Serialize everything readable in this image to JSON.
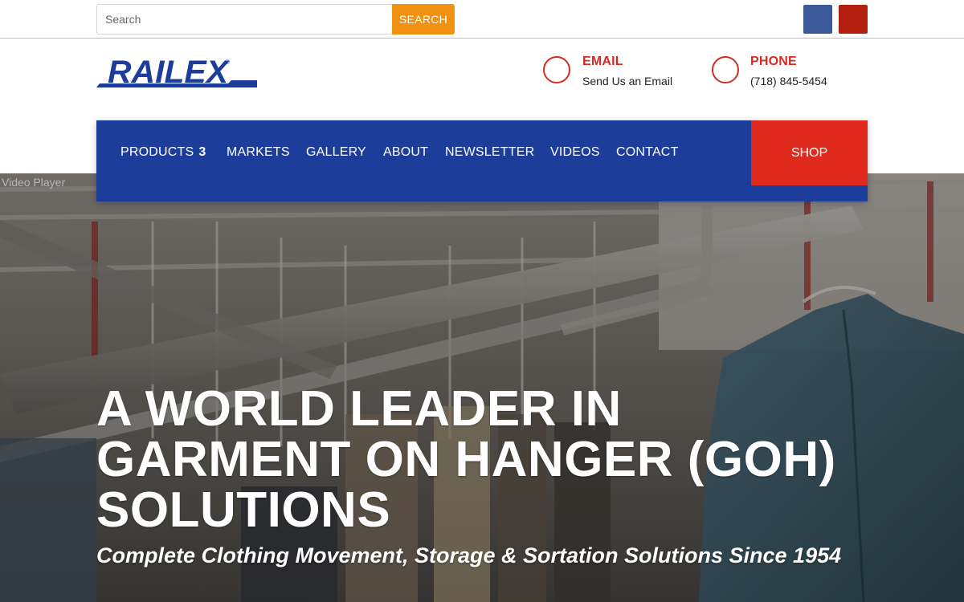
{
  "search": {
    "placeholder": "Search",
    "button_label": "SEARCH"
  },
  "social": [
    {
      "icon": "facebook-icon",
      "color": "#3b5998"
    },
    {
      "icon": "youtube-icon",
      "color": "#b3200f"
    }
  ],
  "brand": {
    "logo_text": "RAILEX",
    "color": "#1d3d9a"
  },
  "contact": {
    "email": {
      "title": "EMAIL",
      "subtitle": "Send Us an Email",
      "icon": "email-icon"
    },
    "phone": {
      "title": "PHONE",
      "subtitle": "(718) 845-5454",
      "icon": "phone-icon"
    }
  },
  "nav": {
    "items": [
      {
        "label": "PRODUCTS",
        "caret": "3"
      },
      {
        "label": "MARKETS"
      },
      {
        "label": "GALLERY"
      },
      {
        "label": "ABOUT"
      },
      {
        "label": "NEWSLETTER"
      },
      {
        "label": "VIDEOS"
      },
      {
        "label": "CONTACT"
      }
    ],
    "shop_label": "SHOP"
  },
  "hero": {
    "video_label": "Video Player",
    "title": "A WORLD LEADER IN GARMENT ON HANGER (GOH) SOLUTIONS",
    "subtitle": "Complete Clothing Movement, Storage & Sortation Solutions Since 1954"
  },
  "colors": {
    "accent_orange": "#f0920f",
    "nav_blue": "#1d3d9a",
    "shop_red": "#df2a1d",
    "contact_red": "#d62b1f"
  }
}
